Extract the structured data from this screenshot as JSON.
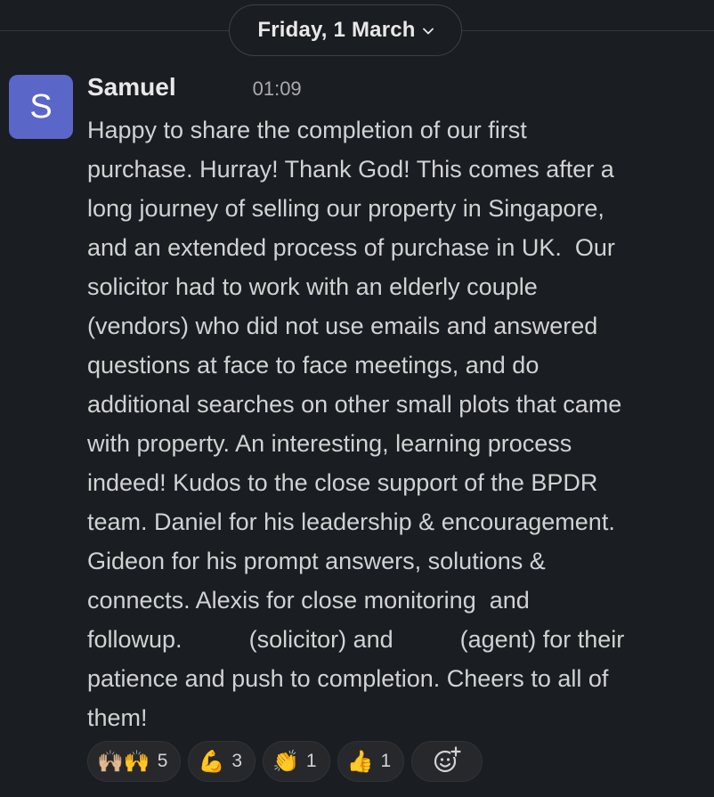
{
  "date_divider": {
    "label": "Friday, 1 March"
  },
  "message": {
    "avatar_letter": "S",
    "author": "Samuel",
    "time": "01:09",
    "lines": [
      "Happy to share the completion of our first",
      "purchase. Hurray! Thank God! This comes after a",
      "long journey of selling our property in Singapore,",
      "and an extended process of purchase in UK.  Our",
      "solicitor had to work with an elderly couple",
      "(vendors) who did not use emails and answered",
      "questions at face to face meetings, and do",
      "additional searches on other small plots that came",
      "with property. An interesting, learning process",
      "indeed! Kudos to the close support of the BPDR",
      "team. Daniel for his leadership & encouragement.",
      "Gideon for his prompt answers, solutions &",
      "connects. Alexis for close monitoring  and",
      "followup.          (solicitor) and          (agent) for their",
      "patience and push to completion. Cheers to all of",
      "them!"
    ]
  },
  "reactions": [
    {
      "emoji": "🙌🏼🙌",
      "icon": "raised-hands-icon",
      "count": "5"
    },
    {
      "emoji": "💪",
      "icon": "flexed-biceps-icon",
      "count": "3"
    },
    {
      "emoji": "👏",
      "icon": "clapping-hands-icon",
      "count": "1"
    },
    {
      "emoji": "👍",
      "icon": "thumbs-up-icon",
      "count": "1"
    }
  ],
  "add_reaction": {
    "icon": "add-emoji-icon"
  },
  "colors": {
    "background": "#1a1d21",
    "avatar": "#5b66c9",
    "text": "#d1d2d3",
    "muted": "#ababad"
  }
}
